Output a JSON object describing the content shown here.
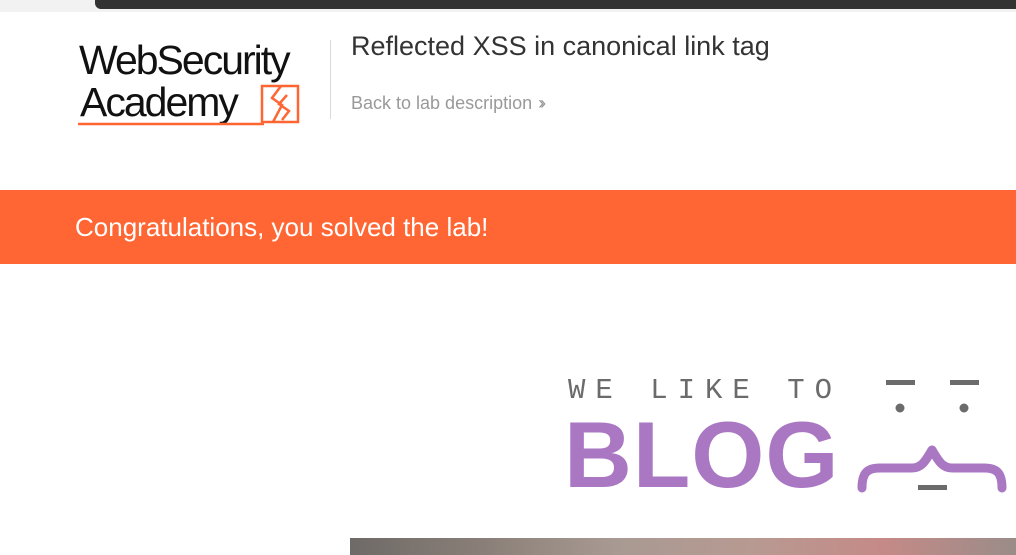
{
  "logo": {
    "line1": "WebSecurity",
    "line2": "Academy"
  },
  "header": {
    "title": "Reflected XSS in canonical link tag",
    "back_link": "Back to lab description",
    "back_icon": "double-chevron-right-icon"
  },
  "banner": {
    "message": "Congratulations, you solved the lab!",
    "color": "#ff6633"
  },
  "blog_header": {
    "tagline": "WE LIKE TO",
    "title": "BLOG",
    "accent_color": "#aa77c3",
    "icon": "face-icon"
  }
}
